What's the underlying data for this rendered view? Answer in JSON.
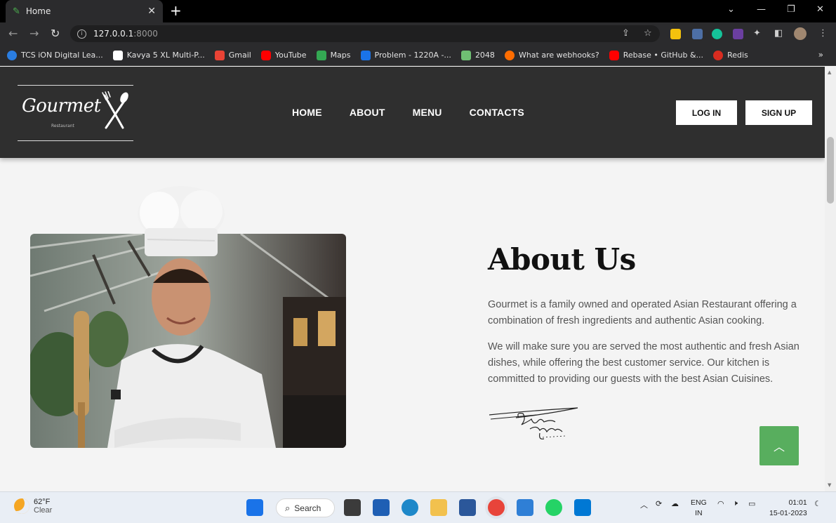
{
  "browser": {
    "tab_title": "Home",
    "url_host": "127.0.0.1",
    "url_port": ":8000",
    "bookmarks": [
      {
        "label": "TCS iON Digital Lea...",
        "color": "#2a7de1"
      },
      {
        "label": "Kavya 5 XL Multi-P...",
        "color": "#ffffff"
      },
      {
        "label": "Gmail",
        "color": "#ea4335"
      },
      {
        "label": "YouTube",
        "color": "#ff0000"
      },
      {
        "label": "Maps",
        "color": "#34a853"
      },
      {
        "label": "Problem - 1220A -...",
        "color": "#1a73e8"
      },
      {
        "label": "2048",
        "color": "#6fbf73"
      },
      {
        "label": "What are webhooks?",
        "color": "#ff6d00"
      },
      {
        "label": "Rebase • GitHub &...",
        "color": "#ff0000"
      },
      {
        "label": "Redis",
        "color": "#d82c20"
      }
    ],
    "more_bookmarks": "»"
  },
  "site": {
    "logo_text": "Gourmet",
    "logo_sub": "Restaurant",
    "nav": [
      "HOME",
      "ABOUT",
      "MENU",
      "CONTACTS"
    ],
    "login_label": "LOG IN",
    "signup_label": "SIGN UP"
  },
  "about": {
    "title": "About Us",
    "paragraph1": "Gourmet is a family owned and operated Asian Restaurant offering a combination of fresh ingredients and authentic Asian cooking.",
    "paragraph2": "We will make sure you are served the most authentic and fresh Asian dishes, while offering the best customer service. Our kitchen is committed to providing our guests with the best Asian Cuisines.",
    "signature": "Kavya Hugale"
  },
  "taskbar": {
    "temperature": "62°F",
    "condition": "Clear",
    "search_label": "Search",
    "lang_line1": "ENG",
    "lang_line2": "IN",
    "time": "01:01",
    "date": "15-01-2023"
  },
  "colors": {
    "accent_green": "#58ae5e",
    "header_bg": "#2f2f2f"
  }
}
